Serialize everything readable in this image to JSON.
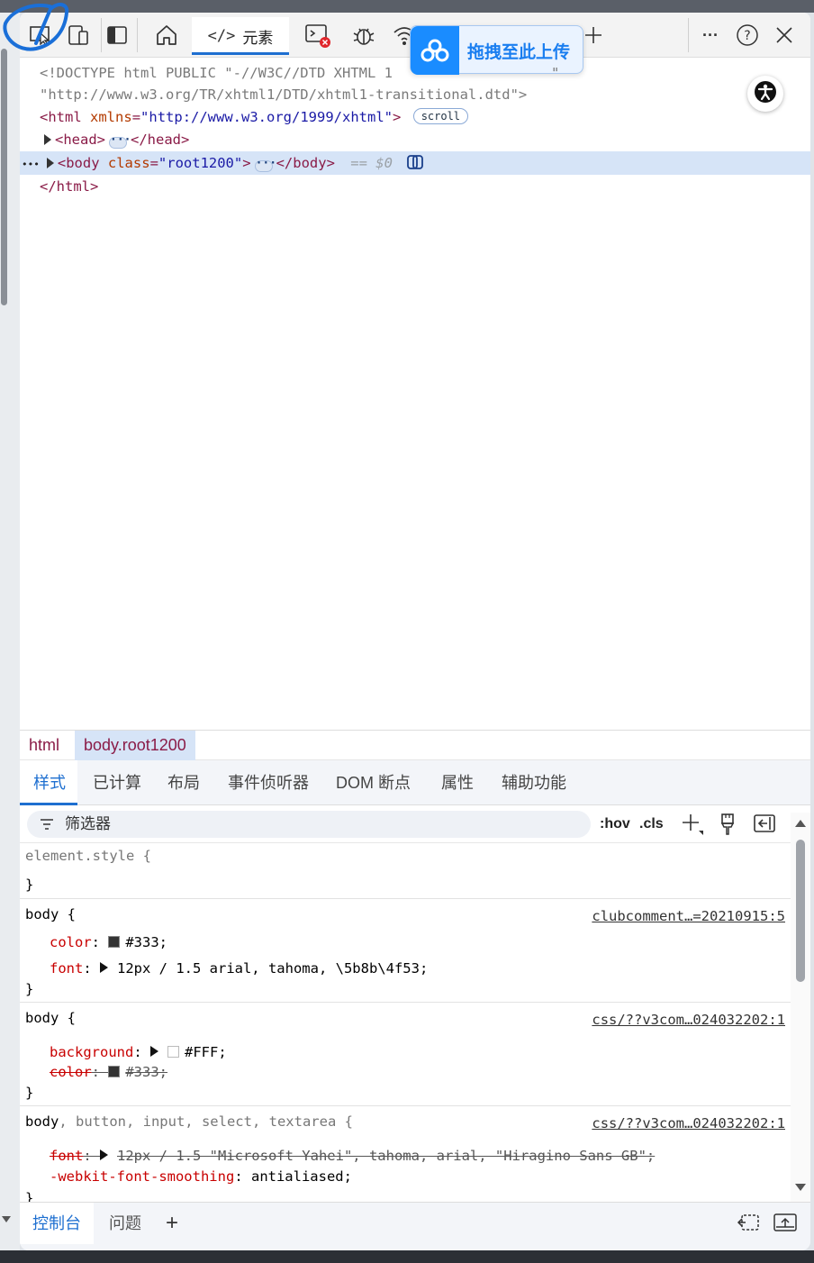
{
  "toolbar": {
    "tabs": [
      {
        "icon": "home-icon"
      },
      {
        "icon": "code-icon",
        "label": "元素",
        "code": "</>"
      },
      {
        "icon": "console-error-icon"
      },
      {
        "icon": "bug-icon"
      },
      {
        "icon": "wifi-icon"
      }
    ],
    "more_label": "···",
    "help_label": "?",
    "close_label": "✕"
  },
  "upload_popup": {
    "label": "拖拽至此上传"
  },
  "dom_tree": {
    "line1_a": "<!DOCTYPE html PUBLIC \"-//W3C//DTD XHTML 1",
    "line1_b": "\"",
    "line2": "\"http://www.w3.org/TR/xhtml1/DTD/xhtml1-transitional.dtd\">",
    "html_open_tag": "<html",
    "html_attr": "xmlns",
    "html_attr_val": "\"http://www.w3.org/1999/xhtml\"",
    "html_close_bracket": ">",
    "scroll_badge": "scroll",
    "head_open": "<head>",
    "head_close": "</head>",
    "body_open_tag": "<body",
    "body_attr": "class",
    "body_attr_val": "\"root1200\"",
    "body_close_bracket": ">",
    "body_close": "</body>",
    "selected_marker": "== $0",
    "row_dots": "•••",
    "html_close": "</html>",
    "ellipsis": "···"
  },
  "breadcrumb": {
    "items": [
      "html",
      "body.root1200"
    ]
  },
  "side_tabs": [
    "样式",
    "已计算",
    "布局",
    "事件侦听器",
    "DOM 断点",
    "属性",
    "辅助功能"
  ],
  "filter": {
    "placeholder": "筛选器",
    "hov": ":hov",
    "cls": ".cls"
  },
  "styles": {
    "element_style": {
      "selector": "element.style {",
      "close": "}"
    },
    "rule1": {
      "selector": "body {",
      "source": "clubcomment…=20210915:5",
      "props": [
        {
          "name": "color",
          "value": "#333;",
          "swatch": "#333333"
        },
        {
          "name": "font",
          "value": "12px / 1.5 arial, tahoma, \\5b8b\\4f53;"
        }
      ],
      "close": "}"
    },
    "rule2": {
      "selector": "body {",
      "source": "css/??v3com…024032202:1",
      "props": [
        {
          "name": "background",
          "value": "#FFF;",
          "swatch": "#FFFFFF"
        },
        {
          "name": "color",
          "value": "#333;",
          "swatch": "#333333",
          "overridden": true
        }
      ],
      "close": "}"
    },
    "rule3": {
      "selector_main": "body",
      "selector_rest": ", button, input, select, textarea {",
      "source": "css/??v3com…024032202:1",
      "props": [
        {
          "name": "font",
          "value": "12px / 1.5 \"Microsoft Yahei\", tahoma, arial, \"Hiragino Sans GB\";",
          "overridden": true
        },
        {
          "name": "-webkit-font-smoothing",
          "value": "antialiased;"
        }
      ],
      "close": "}"
    }
  },
  "drawer": {
    "tabs": [
      "控制台",
      "问题"
    ],
    "add_label": "+"
  },
  "colors": {
    "accent": "#1e6fd0",
    "tag": "#8a1b47",
    "attr": "#b33a00",
    "value": "#1a1aa6",
    "selected_row": "#d6e4f7"
  }
}
